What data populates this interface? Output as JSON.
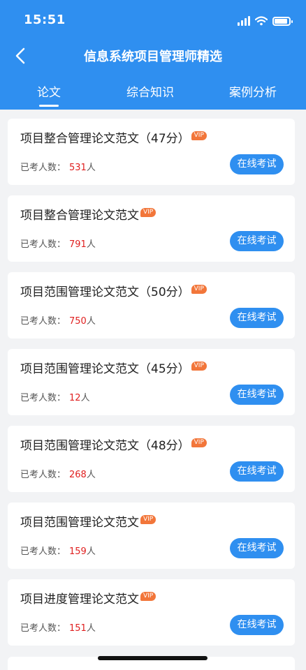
{
  "status_bar": {
    "time": "15:51",
    "icons": [
      "signal-icon",
      "wifi-icon",
      "battery-icon"
    ]
  },
  "nav": {
    "title": "信息系统项目管理师精选",
    "back_icon": "back-arrow-icon"
  },
  "tabs": [
    {
      "label": "论文",
      "active": true
    },
    {
      "label": "综合知识",
      "active": false
    },
    {
      "label": "案例分析",
      "active": false
    }
  ],
  "colors": {
    "primary": "#2f8ff0",
    "vip": "#f2763a",
    "count": "#e02020",
    "background": "#f2f3f5"
  },
  "items": [
    {
      "title": "项目整合管理论文范文（47分）",
      "badge": "VIP",
      "label": "已考人数：",
      "count": "531",
      "unit": "人",
      "button": "在线考试"
    },
    {
      "title": "项目整合管理论文范文",
      "badge": "VIP",
      "label": "已考人数：",
      "count": "791",
      "unit": "人",
      "button": "在线考试"
    },
    {
      "title": "项目范围管理论文范文（50分）",
      "badge": "VIP",
      "label": "已考人数：",
      "count": "750",
      "unit": "人",
      "button": "在线考试"
    },
    {
      "title": "项目范围管理论文范文（45分）",
      "badge": "VIP",
      "label": "已考人数：",
      "count": "12",
      "unit": "人",
      "button": "在线考试"
    },
    {
      "title": "项目范围管理论文范文（48分）",
      "badge": "VIP",
      "label": "已考人数：",
      "count": "268",
      "unit": "人",
      "button": "在线考试"
    },
    {
      "title": "项目范围管理论文范文",
      "badge": "VIP",
      "label": "已考人数：",
      "count": "159",
      "unit": "人",
      "button": "在线考试"
    },
    {
      "title": "项目进度管理论文范文",
      "badge": "VIP",
      "label": "已考人数：",
      "count": "151",
      "unit": "人",
      "button": "在线考试"
    }
  ]
}
